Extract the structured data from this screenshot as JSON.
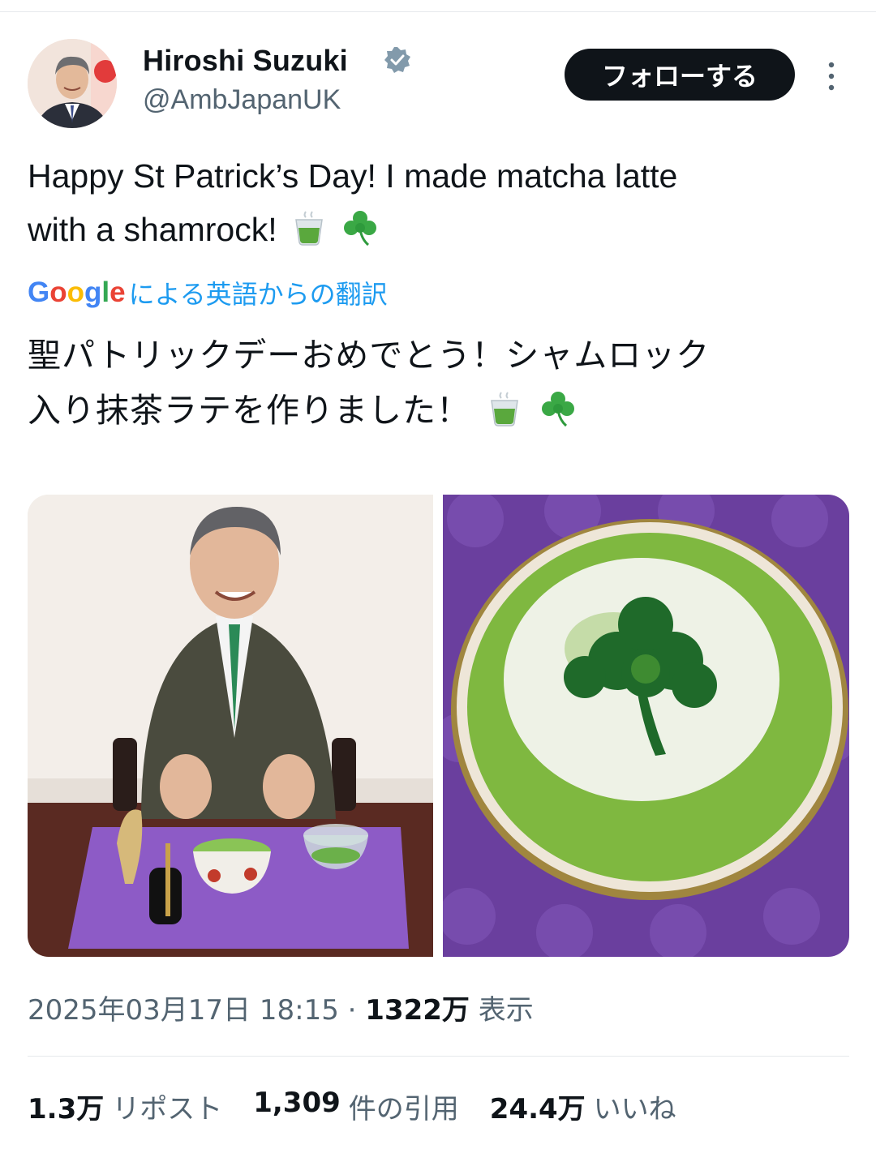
{
  "author": {
    "display_name": "Hiroshi Suzuki",
    "handle": "@AmbJapanUK",
    "verified": true
  },
  "actions": {
    "follow_label": "フォローする"
  },
  "tweet": {
    "text_line1": "Happy St Patrick’s Day! I made matcha latte",
    "text_line2": "with a shamrock!",
    "emojis": [
      "tea-cup-emoji",
      "shamrock-emoji"
    ]
  },
  "translation": {
    "provider_logo": "Google",
    "label": "による英語からの翻訳",
    "text_line1": "聖パトリックデーおめでとう！シャムロック",
    "text_line2": "入り抹茶ラテを作りました！"
  },
  "media": {
    "left_photo": "photo-man-with-matcha-set",
    "right_photo": "photo-matcha-latte-shamrock"
  },
  "meta": {
    "timestamp": "2025年03月17日 18:15",
    "separator": "·",
    "views_count": "1322万",
    "views_label": "表示"
  },
  "stats": [
    {
      "count": "1.3万",
      "label": "リポスト"
    },
    {
      "count": "1,309",
      "label": "件の引用"
    },
    {
      "count": "24.4万",
      "label": "いいね"
    }
  ],
  "colors": {
    "link_blue": "#1d9bf0",
    "text_primary": "#0f1419",
    "text_secondary": "#536471",
    "divider": "#e6e9ec",
    "follow_bg": "#0f1419"
  }
}
